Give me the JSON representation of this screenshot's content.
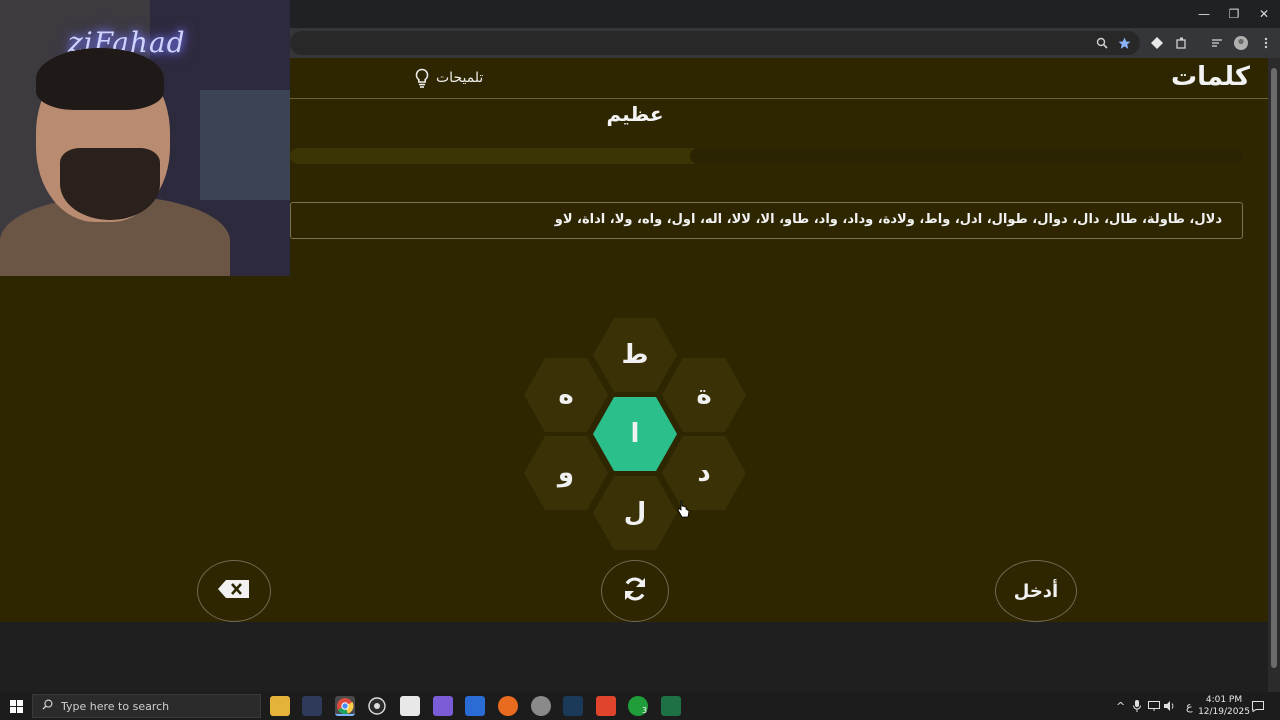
{
  "window": {
    "minimize_glyph": "—",
    "restore_glyph": "❐",
    "close_glyph": "✕"
  },
  "game": {
    "logo": "كلمات",
    "hints_label": "تلميحات",
    "rank": "عظيم",
    "progress": 0.58,
    "found_words": "دلال، طاولة، طال، دال، دوال، طوال، ادل، واط، ولادة، وداد، واد، طاو، الا، لالا، اله، اول، واه، ولا، اداة، لاو",
    "letters": {
      "top": "ط",
      "upper_right": "ة",
      "lower_right": "د",
      "bottom": "ل",
      "lower_left": "و",
      "upper_left": "ه",
      "center": "ا"
    },
    "enter_label": "أدخل",
    "colors": {
      "background": "#2d2600",
      "hex": "#3a3206",
      "center_hex": "#2bbf8b"
    }
  },
  "webcam": {
    "neon_sign": "ziFahad"
  },
  "taskbar": {
    "search_placeholder": "Type here to search",
    "time": "4:01 PM",
    "date": "12/19/2025",
    "lang": "ع",
    "xbox_badge": "3"
  }
}
